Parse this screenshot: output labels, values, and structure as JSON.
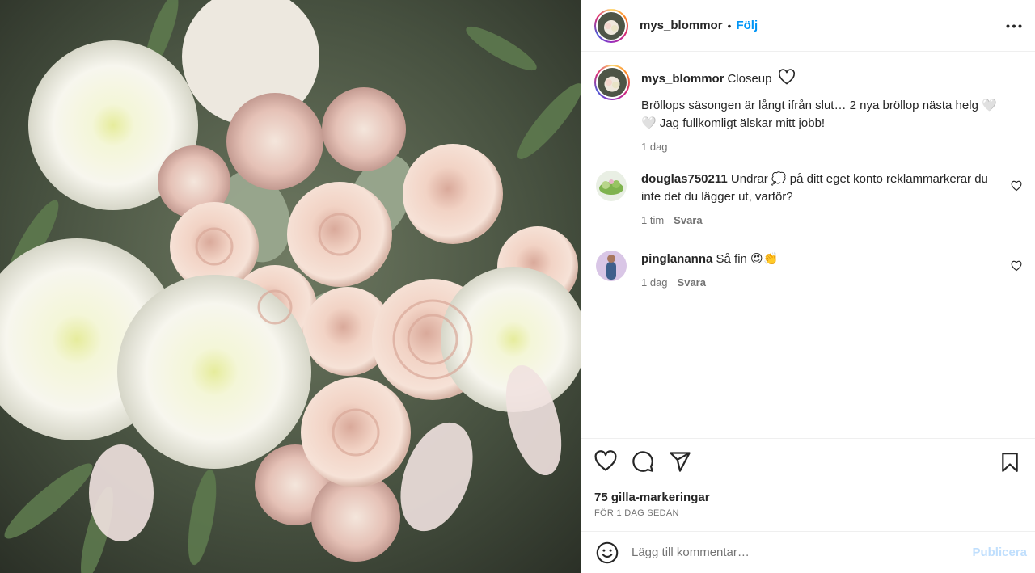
{
  "post": {
    "username": "mys_blommor",
    "dot": "•",
    "follow_label": "Följ",
    "more_icon": "more-horizontal-icon"
  },
  "caption": {
    "username": "mys_blommor",
    "title": "Closeup",
    "text": "Bröllops säsongen är långt ifrån slut… 2 nya bröllop nästa helg 🤍🤍 Jag fullkomligt älskar mitt jobb!",
    "time": "1 dag"
  },
  "comments": [
    {
      "username": "douglas750211",
      "text": "Undrar 💭 på ditt eget konto reklammarkerar du inte det du lägger ut, varför?",
      "time": "1 tim",
      "reply_label": "Svara"
    },
    {
      "username": "pinglananna",
      "text": "Så fin 😍👏",
      "time": "1 dag",
      "reply_label": "Svara"
    }
  ],
  "actions": {
    "like_icon": "heart-icon",
    "comment_icon": "comment-icon",
    "share_icon": "share-icon",
    "save_icon": "bookmark-icon",
    "likes_text": "75 gilla-markeringar",
    "date_text": "FÖR 1 DAG SEDAN"
  },
  "add_comment": {
    "placeholder": "Lägg till kommentar…",
    "publish_label": "Publicera"
  },
  "colors": {
    "link_blue": "#0095f6",
    "publish_disabled": "#c0dffd",
    "secondary_text": "#737373"
  }
}
